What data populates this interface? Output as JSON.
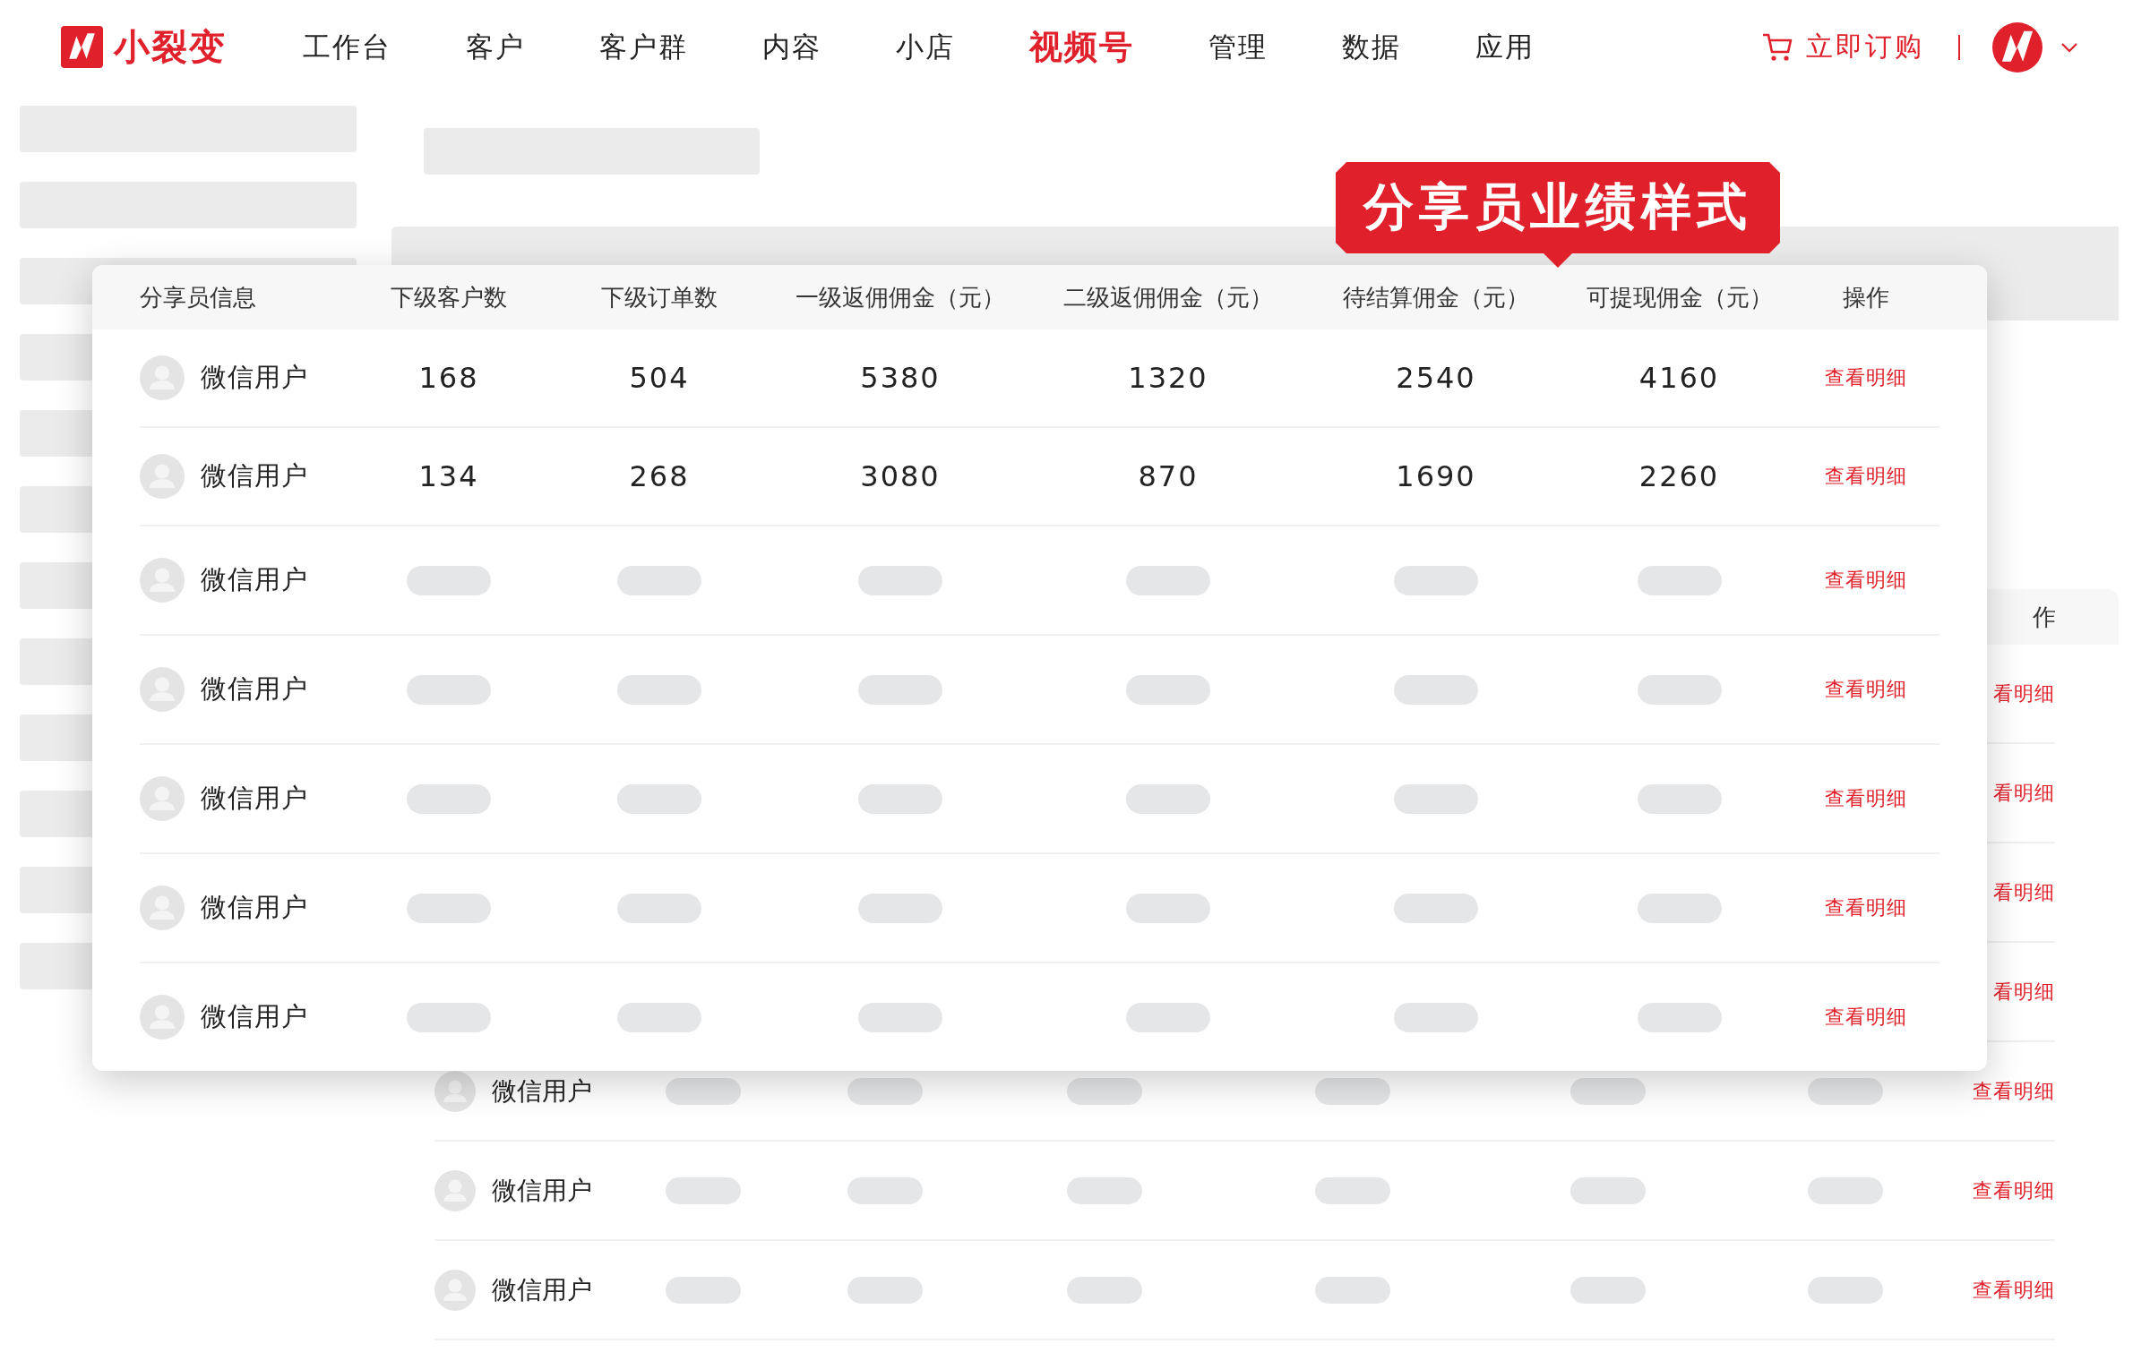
{
  "brand": {
    "name": "小裂变"
  },
  "nav": [
    {
      "label": "工作台",
      "selected": false
    },
    {
      "label": "客户",
      "selected": false
    },
    {
      "label": "客户群",
      "selected": false
    },
    {
      "label": "内容",
      "selected": false
    },
    {
      "label": "小店",
      "selected": false
    },
    {
      "label": "视频号",
      "selected": true
    },
    {
      "label": "管理",
      "selected": false
    },
    {
      "label": "数据",
      "selected": false
    },
    {
      "label": "应用",
      "selected": false
    }
  ],
  "order_link": "立即订购",
  "background_table": {
    "header": "作",
    "rows": [
      {
        "kind": "covered",
        "action": "看明细"
      },
      {
        "kind": "covered",
        "action": "看明细"
      },
      {
        "kind": "covered",
        "action": "看明细"
      },
      {
        "kind": "covered",
        "action": "看明细"
      },
      {
        "kind": "full",
        "name": "微信用户",
        "action": "查看明细"
      },
      {
        "kind": "full",
        "name": "微信用户",
        "action": "查看明细"
      },
      {
        "kind": "full",
        "name": "微信用户",
        "action": "查看明细"
      }
    ]
  },
  "callout": "分享员业绩样式",
  "table": {
    "columns": [
      "分享员信息",
      "下级客户数",
      "下级订单数",
      "一级返佣佣金（元）",
      "二级返佣佣金（元）",
      "待结算佣金（元）",
      "可提现佣金（元）",
      "操作"
    ],
    "rows": [
      {
        "kind": "values",
        "name": "微信用户",
        "values": [
          "168",
          "504",
          "5380",
          "1320",
          "2540",
          "4160"
        ],
        "action": "查看明细"
      },
      {
        "kind": "values",
        "name": "微信用户",
        "values": [
          "134",
          "268",
          "3080",
          "870",
          "1690",
          "2260"
        ],
        "action": "查看明细"
      },
      {
        "kind": "placeholder",
        "name": "微信用户",
        "action": "查看明细"
      },
      {
        "kind": "placeholder",
        "name": "微信用户",
        "action": "查看明细"
      },
      {
        "kind": "placeholder",
        "name": "微信用户",
        "action": "查看明细"
      },
      {
        "kind": "placeholder",
        "name": "微信用户",
        "action": "查看明细"
      },
      {
        "kind": "placeholder",
        "name": "微信用户",
        "action": "查看明细"
      }
    ]
  }
}
